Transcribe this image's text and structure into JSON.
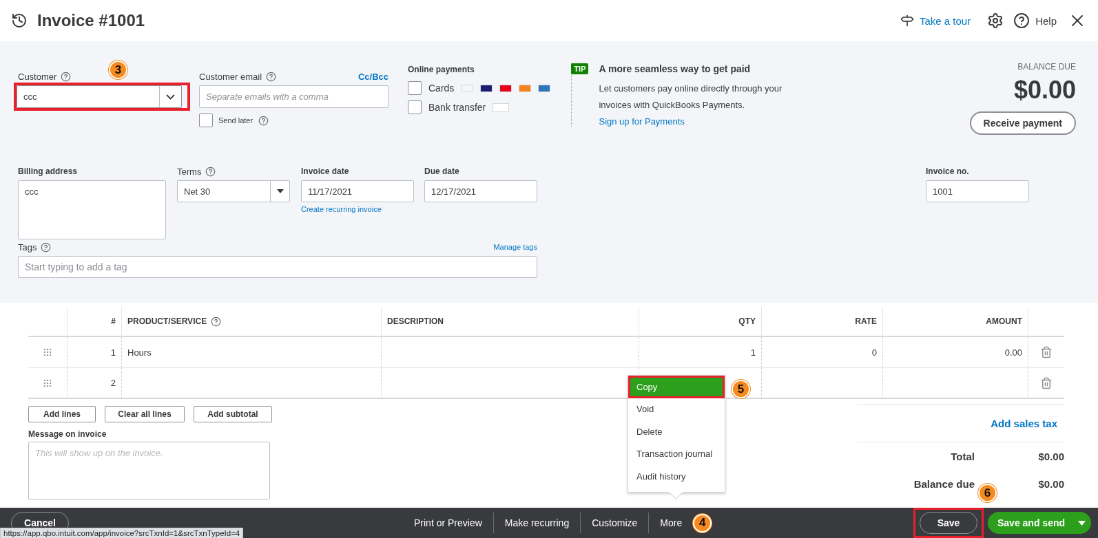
{
  "header": {
    "title": "Invoice #1001",
    "tour": "Take a tour",
    "help": "Help"
  },
  "customer": {
    "label": "Customer",
    "value": "ccc",
    "highlighted": true,
    "callout": "3"
  },
  "customer_email": {
    "label": "Customer email",
    "cc_bcc": "Cc/Bcc",
    "placeholder": "Separate emails with a comma",
    "send_later": {
      "label": "Send later",
      "checked": false
    }
  },
  "online_payments": {
    "title": "Online payments",
    "options": [
      {
        "label": "Cards",
        "checked": false,
        "kind": "cards"
      },
      {
        "label": "Bank transfer",
        "checked": false,
        "kind": "bank"
      }
    ]
  },
  "tip": {
    "badge": "TIP",
    "title": "A more seamless way to get paid",
    "text": "Let customers pay online directly through your invoices with QuickBooks Payments.",
    "link": "Sign up for Payments"
  },
  "balance": {
    "label": "BALANCE DUE",
    "amount": "$0.00",
    "button": "Receive payment"
  },
  "billing_address": {
    "label": "Billing address",
    "value": "ccc"
  },
  "terms": {
    "label": "Terms",
    "value": "Net 30"
  },
  "invoice_date": {
    "label": "Invoice date",
    "value": "11/17/2021",
    "link": "Create recurring invoice"
  },
  "due_date": {
    "label": "Due date",
    "value": "12/17/2021"
  },
  "invoice_no": {
    "label": "Invoice no.",
    "value": "1001"
  },
  "tags": {
    "label": "Tags",
    "link": "Manage tags",
    "placeholder": "Start typing to add a tag"
  },
  "table": {
    "columns": [
      "#",
      "PRODUCT/SERVICE",
      "DESCRIPTION",
      "QTY",
      "RATE",
      "AMOUNT"
    ],
    "rows": [
      {
        "number": "1",
        "product": "Hours",
        "qty": "1",
        "rate": "0",
        "amount": "0.00"
      },
      {
        "number": "2"
      }
    ]
  },
  "line_buttons": [
    "Add lines",
    "Clear all lines",
    "Add subtotal"
  ],
  "message": {
    "label": "Message on invoice",
    "placeholder": "This will show up on the invoice."
  },
  "totals": {
    "add_sales_tax": "Add sales tax",
    "rows": [
      {
        "label": "Total",
        "value": "$0.00"
      },
      {
        "label": "Balance due",
        "value": "$0.00"
      }
    ]
  },
  "more_menu": {
    "items": [
      {
        "label": "Copy",
        "selected": true,
        "highlighted": true,
        "callout": "5"
      },
      {
        "label": "Void",
        "selected": false,
        "highlighted": false
      },
      {
        "label": "Delete",
        "selected": false,
        "highlighted": false
      },
      {
        "label": "Transaction journal",
        "selected": false,
        "highlighted": false
      },
      {
        "label": "Audit history",
        "selected": false,
        "highlighted": false
      }
    ]
  },
  "footer": {
    "cancel": "Cancel",
    "links": [
      "Print or Preview",
      "Make recurring",
      "Customize"
    ],
    "more": {
      "label": "More",
      "callout": "4"
    },
    "save": {
      "label": "Save",
      "highlighted": true,
      "callout": "6"
    },
    "save_and_send": "Save and send"
  },
  "status_url": "https://app.qbo.intuit.com/app/invoice?srcTxnId=1&srcTxnTypeId=4"
}
